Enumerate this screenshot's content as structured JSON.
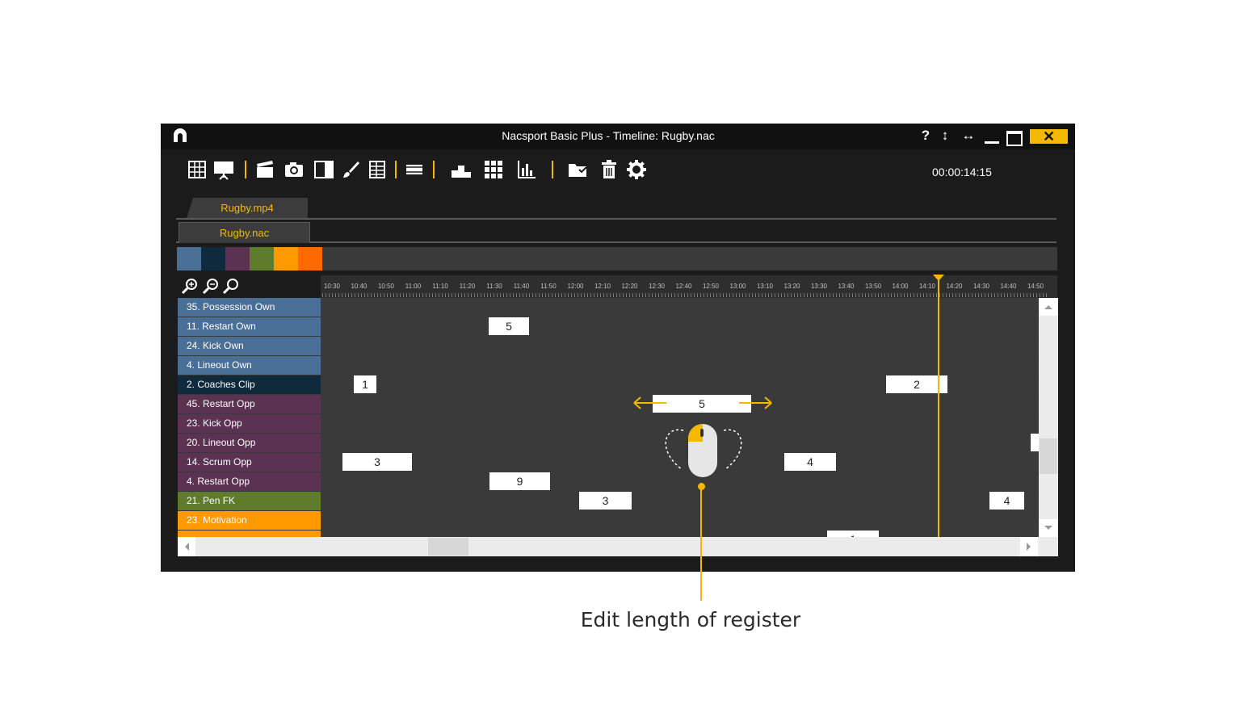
{
  "window": {
    "title": "Nacsport Basic Plus - Timeline: Rugby.nac",
    "help": "?",
    "vert_resize": "↕",
    "horiz_resize": "↔",
    "close": "✕"
  },
  "toolbar": {
    "clock": "00:00:14:15",
    "tools": [
      "grid-icon",
      "presentation-icon",
      "clapperboard-icon",
      "camera-icon",
      "split-view-icon",
      "brush-icon",
      "table-icon",
      "film-strip-icon",
      "podium-icon",
      "matrix-icon",
      "bar-chart-icon",
      "folder-icon",
      "trash-icon",
      "gear-icon"
    ]
  },
  "tabs": {
    "video": "Rugby.mp4",
    "timeline": "Rugby.nac"
  },
  "colors": {
    "accent": "#f5b800",
    "swatches": [
      "#4a6f97",
      "#0e2a3c",
      "#5b3251",
      "#5e7c2c",
      "#ff9900",
      "#ff6a00"
    ]
  },
  "ruler": {
    "ticks": [
      "10:30",
      "10:40",
      "10:50",
      "11:00",
      "11:10",
      "11:20",
      "11:30",
      "11:40",
      "11:50",
      "12:00",
      "12:10",
      "12:20",
      "12:30",
      "12:40",
      "12:50",
      "13:00",
      "13:10",
      "13:20",
      "13:30",
      "13:40",
      "13:50",
      "14:00",
      "14:10",
      "14:20",
      "14:30",
      "14:40",
      "14:50"
    ]
  },
  "rows": [
    {
      "label": "35. Possession Own",
      "color": "#4a6f97"
    },
    {
      "label": "11. Restart Own",
      "color": "#4a6f97"
    },
    {
      "label": "24. Kick Own",
      "color": "#4a6f97"
    },
    {
      "label": "4. Lineout Own",
      "color": "#4a6f97"
    },
    {
      "label": "2. Coaches Clip",
      "color": "#0e2a3c"
    },
    {
      "label": "45. Restart Opp",
      "color": "#5b3251"
    },
    {
      "label": "23. Kick Opp",
      "color": "#5b3251"
    },
    {
      "label": "20. Lineout Opp",
      "color": "#5b3251"
    },
    {
      "label": "14. Scrum Opp",
      "color": "#5b3251"
    },
    {
      "label": "4. Restart Opp",
      "color": "#5b3251"
    },
    {
      "label": "21. Pen FK",
      "color": "#5e7c2c"
    },
    {
      "label": "23. Motivation",
      "color": "#ff9900"
    },
    {
      "label": "",
      "color": "#ff9900"
    }
  ],
  "clips": [
    {
      "row": 1,
      "label": "5"
    },
    {
      "row": 4,
      "label": "1"
    },
    {
      "row": 4,
      "label": "2"
    },
    {
      "row": 5,
      "label": "5"
    },
    {
      "row": 8,
      "label": "3"
    },
    {
      "row": 8,
      "label": "4"
    },
    {
      "row": 9,
      "label": "9"
    },
    {
      "row": 10,
      "label": "3"
    },
    {
      "row": 10,
      "label": "4"
    },
    {
      "row": 12,
      "label": "1"
    }
  ],
  "caption": "Edit length of register"
}
